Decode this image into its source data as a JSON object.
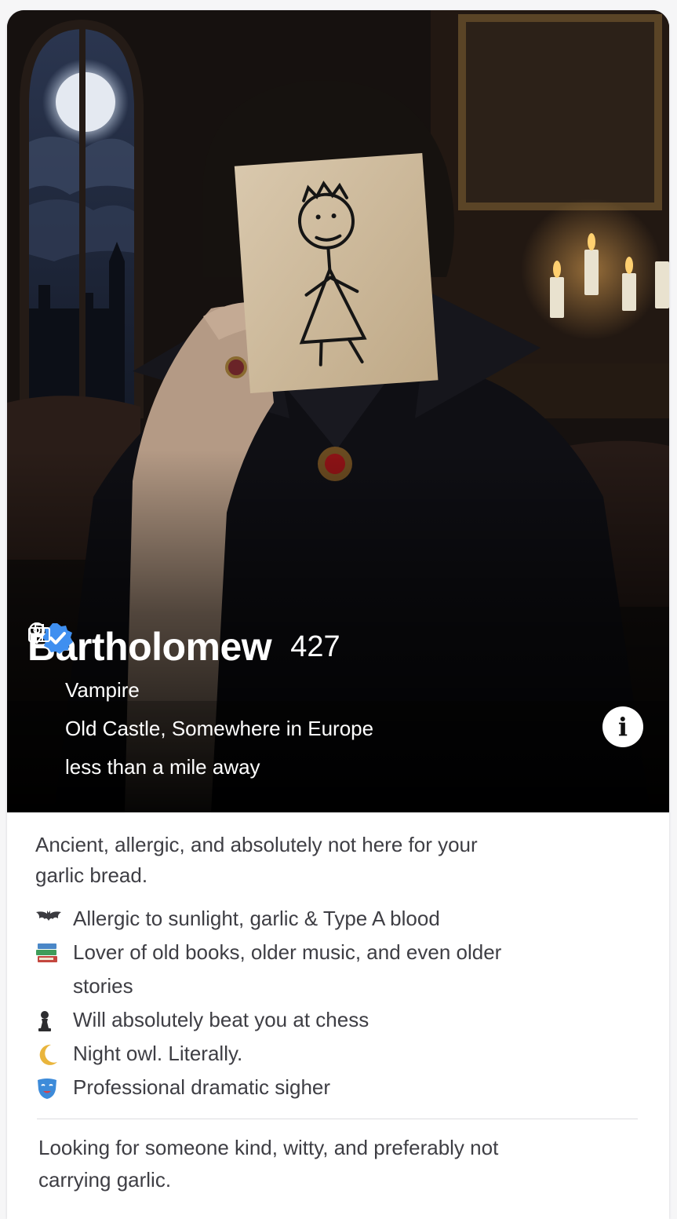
{
  "profile": {
    "name": "Bartholomew",
    "age": "427",
    "verified": true,
    "job": "Vampire",
    "location": "Old Castle, Somewhere in Europe",
    "distance": "less than a mile away"
  },
  "icons": {
    "job": "briefcase-icon",
    "location": "location-pin-icon",
    "distance": "location-pin-icon",
    "verified": "verified-badge-icon",
    "info": "info-icon"
  },
  "bio": {
    "intro": "Ancient, allergic, and absolutely not here for your garlic bread.",
    "items": [
      {
        "icon": "bat",
        "text": "Allergic to sunlight, garlic & Type A blood"
      },
      {
        "icon": "books",
        "text": "Lover of old books, older music, and even older stories"
      },
      {
        "icon": "chess-pawn",
        "text": "Will absolutely beat you at chess"
      },
      {
        "icon": "crescent-moon",
        "text": "Night owl. Literally."
      },
      {
        "icon": "theater-mask",
        "text": "Professional dramatic sigher"
      }
    ],
    "looking_for": "Looking for someone kind, witty, and preferably not carrying garlic."
  },
  "colors": {
    "verified_badge": "#3f8ff0",
    "text": "#3e3e44",
    "photo_overlay": "#000000"
  }
}
